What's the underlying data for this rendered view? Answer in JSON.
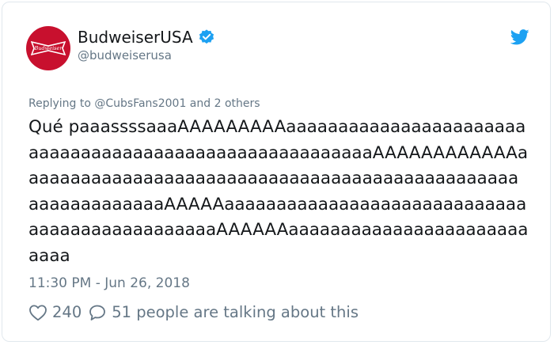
{
  "author": {
    "display_name": "BudweiserUSA",
    "handle": "@budweiserusa",
    "verified": true,
    "avatar_icon": "budweiser-bowtie-logo",
    "avatar_color": "#c8102e",
    "avatar_logo_text": "Budweiser"
  },
  "platform_icon": "twitter-bird-icon",
  "accent_color": "#1da1f2",
  "reply_context": "Replying to @CubsFans2001 and 2 others",
  "tweet_text": "Qué paaassssaaaAAAAAAAAAaaaaaaaaaaaaaaaaaaaaaaaaaaaaaaaaaaaaaaaaaaaaaaaaaaaaaaaaAAAAAAAAAAAAaaaaaaaaaaaaaaaaaaaaaaaaaaaaaaaaaaaaaaaaaaaaaaaaaaaaaaaaaaaaaAAAAAaaaaaaaaaaaaaaaaaaaaaaaaaaaaaaaaaaaaaaaaaaaaaaaAAAAAAaaaaaaaaaaaaaaaaaaaaaaaaaaa",
  "timestamp": "11:30 PM - Jun 26, 2018",
  "actions": {
    "like_icon": "heart-icon",
    "like_count": "240",
    "reply_icon": "speech-bubble-icon",
    "talking_text": "51 people are talking about this"
  }
}
